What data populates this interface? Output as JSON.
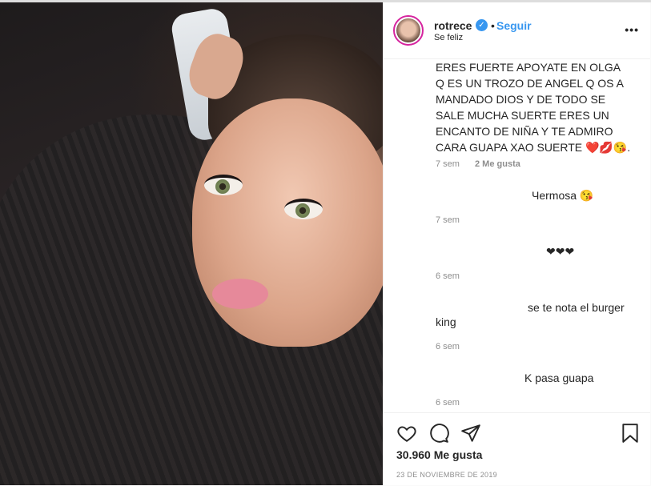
{
  "post": {
    "username": "rotrece",
    "verified_icon": "verified-check-icon",
    "separator": "•",
    "follow_label": "Seguir",
    "location": "Se feliz",
    "more_icon": "•••"
  },
  "comments": [
    {
      "lines": [
        "ERES FUERTE APOYATE EN OLGA",
        "Q ES UN TROZO DE ANGEL Q OS A",
        "MANDADO DIOS Y DE TODO SE",
        "SALE MUCHA SUERTE ERES UN",
        "ENCANTO DE NIÑA Y TE ADMIRO",
        "CARA GUAPA XAO SUERTE ❤️💋😘."
      ],
      "time": "7 sem",
      "likes": "2 Me gusta"
    },
    {
      "lines": [
        "Чermosa 😘"
      ],
      "time": "7 sem"
    },
    {
      "lines": [
        "❤❤❤"
      ],
      "time": "6 sem"
    },
    {
      "lines": [
        "se te nota el burger",
        "king"
      ],
      "time": "6 sem"
    },
    {
      "lines": [
        "K pasa guapa"
      ],
      "time": "6 sem"
    }
  ],
  "footer": {
    "likes": "30.960 Me gusta",
    "date": "23 DE NOVIEMBRE DE 2019"
  }
}
